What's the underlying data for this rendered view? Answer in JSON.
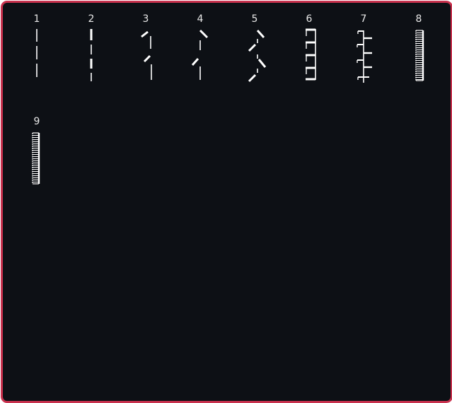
{
  "stitch_menu": {
    "stitches": [
      {
        "number": "1",
        "icon": "straight-stitch-icon"
      },
      {
        "number": "2",
        "icon": "triple-straight-stitch-icon"
      },
      {
        "number": "3",
        "icon": "feather-stitch-icon"
      },
      {
        "number": "4",
        "icon": "feather-stitch-wide-icon"
      },
      {
        "number": "5",
        "icon": "zigzag-feather-stitch-icon"
      },
      {
        "number": "6",
        "icon": "blanket-stitch-icon"
      },
      {
        "number": "7",
        "icon": "double-blanket-stitch-icon"
      },
      {
        "number": "8",
        "icon": "satin-bartack-stitch-icon"
      },
      {
        "number": "9",
        "icon": "satin-bartack-stitch-icon"
      }
    ]
  },
  "colors": {
    "frame_border": "#c8324e",
    "background": "#0d1015",
    "stitch_line": "#ffffff",
    "number_text": "#e8e8e8"
  }
}
